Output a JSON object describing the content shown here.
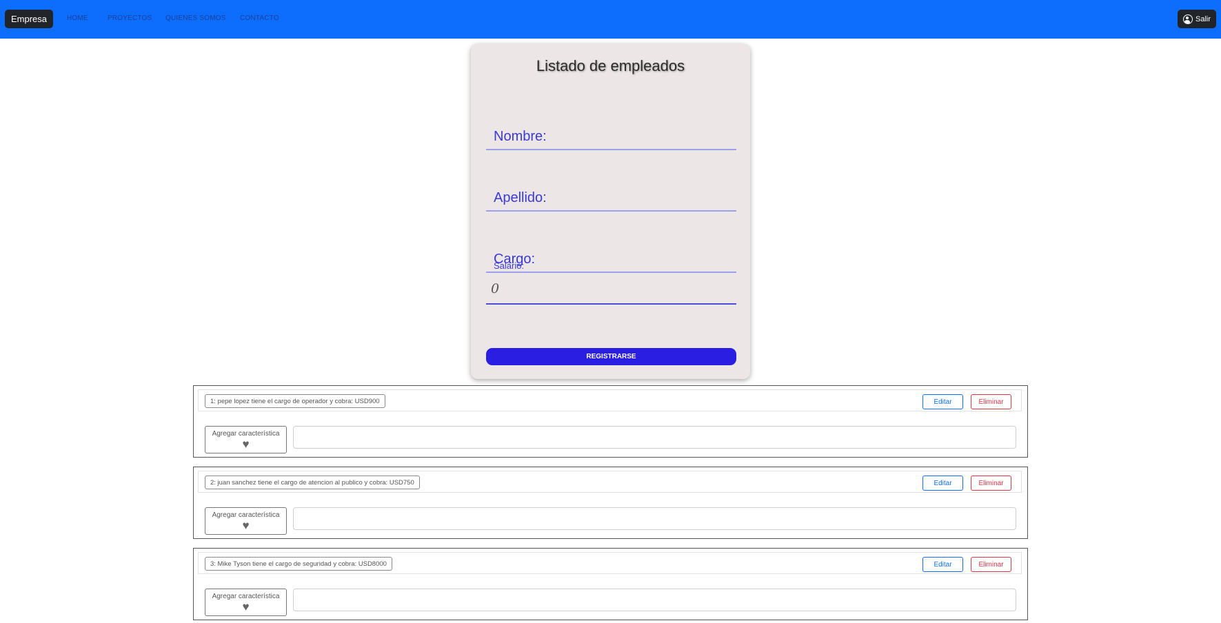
{
  "navbar": {
    "brand": "Empresa",
    "links": [
      "HOME",
      "PROYECTOS",
      "QUIENES SOMOS",
      "CONTACTO"
    ],
    "logout_label": "Salir",
    "logout_icon": "user-circle-icon",
    "color": "#0d6efd"
  },
  "form": {
    "title": "Listado de empleados",
    "nombre_label": "Nombre:",
    "apellido_label": "Apellido:",
    "cargo_label": "Cargo:",
    "salario_label": "Salario:",
    "salario_value": "0",
    "submit_label": "REGISTRARSE",
    "submit_color": "#2a1ee3"
  },
  "employees": [
    {
      "text": "1: pepe lopez tiene el cargo de operador y cobra: USD900",
      "edit_label": "Editar",
      "delete_label": "Eliminar",
      "add_label": "Agregar característica",
      "add_icon": "heart-icon",
      "feature_value": ""
    },
    {
      "text": "2: juan sanchez tiene el cargo de atencion al publico y cobra: USD750",
      "edit_label": "Editar",
      "delete_label": "Eliminar",
      "add_label": "Agregar característica",
      "add_icon": "heart-icon",
      "feature_value": ""
    },
    {
      "text": "3: Mike Tyson tiene el cargo de seguridad y cobra: USD8000",
      "edit_label": "Editar",
      "delete_label": "Eliminar",
      "add_label": "Agregar característica",
      "add_icon": "heart-icon",
      "feature_value": ""
    }
  ]
}
